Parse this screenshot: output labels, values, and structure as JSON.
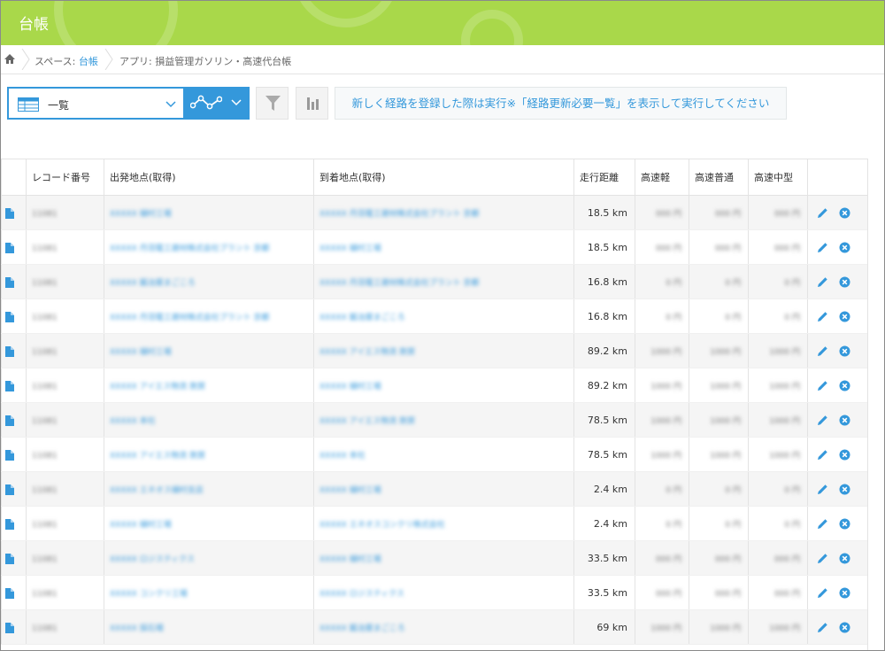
{
  "app": {
    "title": "台帳"
  },
  "breadcrumb": {
    "space_prefix": "スペース: ",
    "space_link": "台帳",
    "app_label": "アプリ: 損益管理ガソリン・高速代台帳"
  },
  "toolbar": {
    "view_label": "一覧",
    "action_button": "新しく経路を登録した際は実行※「経路更新必要一覧」を表示して実行してください"
  },
  "colors": {
    "accent": "#3498db",
    "header_green": "#a9d84a"
  },
  "table": {
    "columns": [
      "レコード番号",
      "出発地点(取得)",
      "到着地点(取得)",
      "走行距離",
      "高速軽",
      "高速普通",
      "高速中型"
    ],
    "rows": [
      {
        "record": "11081",
        "from": "XXXXX 樋村工場",
        "to": "XXXXX 丹羽電工建材株式会社プラント 京都",
        "distance": "18.5 km",
        "light": "000 円",
        "normal": "000 円",
        "medium": "000 円"
      },
      {
        "record": "11081",
        "from": "XXXXX 丹羽電工建材株式会社プラント 京都",
        "to": "XXXXX 樋村工場",
        "distance": "18.5 km",
        "light": "000 円",
        "normal": "000 円",
        "medium": "000 円"
      },
      {
        "record": "11081",
        "from": "XXXXX 鍛冶屋まごころ",
        "to": "XXXXX 丹羽電工建材株式会社プラント 京都",
        "distance": "16.8 km",
        "light": "0 円",
        "normal": "0 円",
        "medium": "0 円"
      },
      {
        "record": "11081",
        "from": "XXXXX 丹羽電工建材株式会社プラント 京都",
        "to": "XXXXX 鍛冶屋まごころ",
        "distance": "16.8 km",
        "light": "0 円",
        "normal": "0 円",
        "medium": "0 円"
      },
      {
        "record": "11081",
        "from": "XXXXX 樋村工場",
        "to": "XXXXX アイエス物流 敦賀",
        "distance": "89.2 km",
        "light": "1000 円",
        "normal": "1000 円",
        "medium": "1000 円"
      },
      {
        "record": "11081",
        "from": "XXXXX アイエス物流 敦賀",
        "to": "XXXXX 樋村工場",
        "distance": "89.2 km",
        "light": "1000 円",
        "normal": "1000 円",
        "medium": "1000 円"
      },
      {
        "record": "11081",
        "from": "XXXXX 本社",
        "to": "XXXXX アイエス物流 敦賀",
        "distance": "78.5 km",
        "light": "1000 円",
        "normal": "1000 円",
        "medium": "1000 円"
      },
      {
        "record": "11081",
        "from": "XXXXX アイエス物流 敦賀",
        "to": "XXXXX 本社",
        "distance": "78.5 km",
        "light": "1000 円",
        "normal": "1000 円",
        "medium": "1000 円"
      },
      {
        "record": "11081",
        "from": "XXXXX エネオス樋村支店",
        "to": "XXXXX 樋村工場",
        "distance": "2.4 km",
        "light": "0 円",
        "normal": "0 円",
        "medium": "0 円"
      },
      {
        "record": "11081",
        "from": "XXXXX 樋村工場",
        "to": "XXXXX エネオスコンクリ株式会社",
        "distance": "2.4 km",
        "light": "0 円",
        "normal": "0 円",
        "medium": "0 円"
      },
      {
        "record": "11081",
        "from": "XXXXX ロジスティクス",
        "to": "XXXXX 樋村工場",
        "distance": "33.5 km",
        "light": "000 円",
        "normal": "000 円",
        "medium": "000 円"
      },
      {
        "record": "11081",
        "from": "XXXXX コンクリ工場",
        "to": "XXXXX ロジスティクス",
        "distance": "33.5 km",
        "light": "000 円",
        "normal": "000 円",
        "medium": "000 円"
      },
      {
        "record": "11081",
        "from": "XXXXX 採石場",
        "to": "XXXXX 鍛冶屋まごころ",
        "distance": "69 km",
        "light": "1000 円",
        "normal": "1000 円",
        "medium": "1000 円"
      }
    ]
  }
}
